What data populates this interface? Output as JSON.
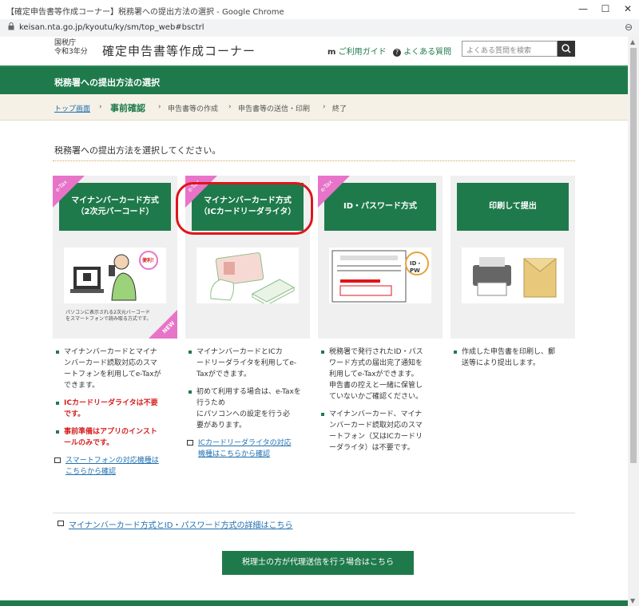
{
  "window": {
    "title": "【確定申告書等作成コーナー】税務署への提出方法の選択 - Google Chrome",
    "url": "keisan.nta.go.jp/kyoutu/ky/sm/top_web#bsctrl",
    "minimize": "—",
    "maximize": "☐",
    "close": "✕",
    "zoom_icon": "⊖"
  },
  "header": {
    "agency_line1": "国税庁",
    "agency_line2": "令和3年分",
    "app_title": "確定申告書等作成コーナー",
    "guide_link": "ご利用ガイド",
    "faq_link": "よくある質問",
    "search_placeholder": "よくある質問を検索"
  },
  "page_title": "税務署への提出方法の選択",
  "breadcrumb": {
    "items": [
      "トップ画面",
      "事前確認",
      "申告書等の作成",
      "申告書等の送信・印刷",
      "終了"
    ],
    "sep": "›"
  },
  "instruction": "税務署への提出方法を選択してください。",
  "cards": [
    {
      "title": "マイナンバーカード方式\n（2次元バーコード）",
      "badge": "e-Tax",
      "caption": "パソコンに表示される2次元バーコード\nをスマートフォンで読み取る方式です。",
      "new_label": "NEW",
      "image_note": "便利！"
    },
    {
      "title": "マイナンバーカード方式\n（ICカードリーダライタ）",
      "badge": "e-Tax"
    },
    {
      "title": "ID・パスワード方式",
      "badge": "e-Tax",
      "image_note": "ID・PW"
    },
    {
      "title": "印刷して提出"
    }
  ],
  "desc": {
    "col1": {
      "b1": "マイナンバーカードとマイナ\nンバーカード読取対応のスマ\nートフォンを利用してe-Taxが\nできます。",
      "b2": "ICカードリーダライタは不要\nです。",
      "b3": "事前準備はアプリのインスト\nールのみです。",
      "link": "スマートフォンの対応機種は\nこちらから確認"
    },
    "col2": {
      "b1": "マイナンバーカードとICカ\nードリーダライタを利用してe-\nTaxができます。",
      "b2": "初めて利用する場合は、e-Taxを行うため\nにパソコンへの設定を行う必\n要があります。",
      "link": "ICカードリーダライタの対応\n機種はこちらから確認"
    },
    "col3": {
      "b1": "税務署で発行されたID・パス\nワード方式の届出完了通知を\n利用してe-Taxができます。\n申告書の控えと一緒に保管し\nていないかご確認ください。",
      "b2": "マイナンバーカード、マイナ\nンバーカード読取対応のスマ\nートフォン（又はICカードリ\nーダライタ）は不要です。"
    },
    "col4": {
      "b1": "作成した申告書を印刷し、郵\n送等により提出します。"
    }
  },
  "bottom_link": "マイナンバーカード方式とID・パスワード方式の詳細はこちら",
  "cta": "税理士の方が代理送信を行う場合はこちら",
  "colors": {
    "green": "#1f7a4b",
    "pink": "#e774c8",
    "highlight": "#e0141b"
  }
}
